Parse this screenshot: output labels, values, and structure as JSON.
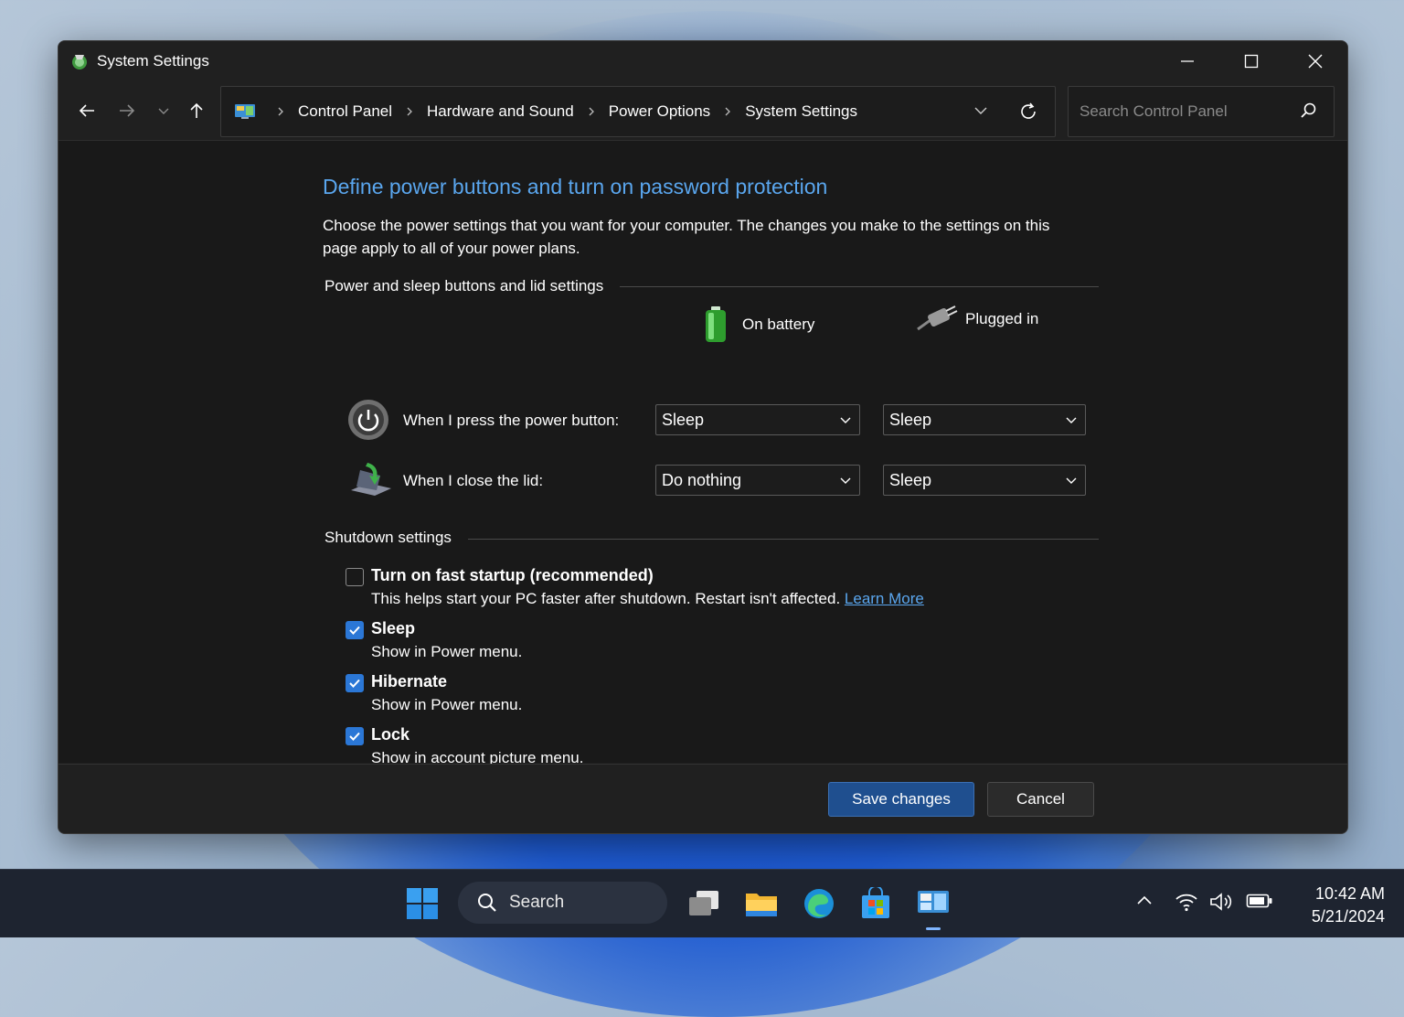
{
  "window": {
    "title": "System Settings"
  },
  "toolbar": {
    "breadcrumbs": [
      "Control Panel",
      "Hardware and Sound",
      "Power Options",
      "System Settings"
    ],
    "search_placeholder": "Search Control Panel"
  },
  "page": {
    "heading": "Define power buttons and turn on password protection",
    "description": "Choose the power settings that you want for your computer. The changes you make to the settings on this page apply to all of your power plans.",
    "power_section": {
      "title": "Power and sleep buttons and lid settings",
      "col_battery": "On battery",
      "col_plugged": "Plugged in",
      "rows": [
        {
          "label": "When I press the power button:",
          "battery": "Sleep",
          "plugged": "Sleep"
        },
        {
          "label": "When I close the lid:",
          "battery": "Do nothing",
          "plugged": "Sleep"
        }
      ]
    },
    "shutdown_section": {
      "title": "Shutdown settings",
      "options": [
        {
          "title": "Turn on fast startup (recommended)",
          "desc": "This helps start your PC faster after shutdown. Restart isn't affected.",
          "link": "Learn More",
          "checked": false
        },
        {
          "title": "Sleep",
          "desc": "Show in Power menu.",
          "checked": true
        },
        {
          "title": "Hibernate",
          "desc": "Show in Power menu.",
          "checked": true
        },
        {
          "title": "Lock",
          "desc": "Show in account picture menu.",
          "checked": true
        }
      ]
    }
  },
  "footer": {
    "save_label": "Save changes",
    "cancel_label": "Cancel"
  },
  "taskbar": {
    "search_label": "Search",
    "time": "10:42 AM",
    "date": "5/21/2024"
  },
  "colors": {
    "accent": "#2b77d6",
    "heading": "#5aa6ee",
    "window_bg": "#191919"
  }
}
